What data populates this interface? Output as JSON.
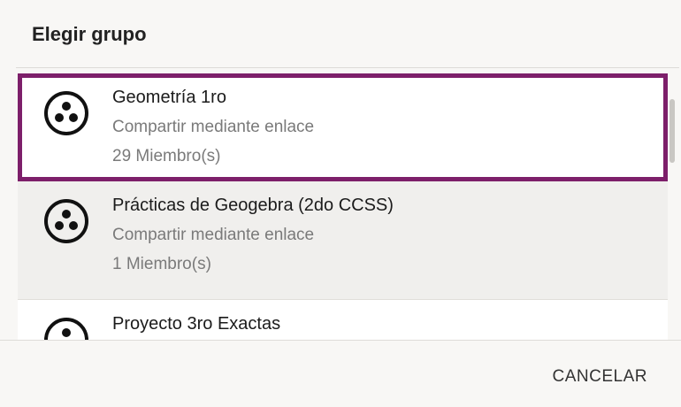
{
  "dialog": {
    "title": "Elegir grupo",
    "cancel_label": "CANCELAR"
  },
  "groups": [
    {
      "name": "Geometría 1ro",
      "share": "Compartir mediante enlace",
      "members": "29 Miembro(s)",
      "selected": true
    },
    {
      "name": "Prácticas de Geogebra (2do CCSS)",
      "share": "Compartir mediante enlace",
      "members": "1 Miembro(s)",
      "selected": false
    },
    {
      "name": "Proyecto 3ro Exactas",
      "share": "",
      "members": "",
      "selected": false
    }
  ],
  "icons": {
    "group": "group-icon"
  },
  "colors": {
    "selection_border": "#7d1f6a"
  }
}
